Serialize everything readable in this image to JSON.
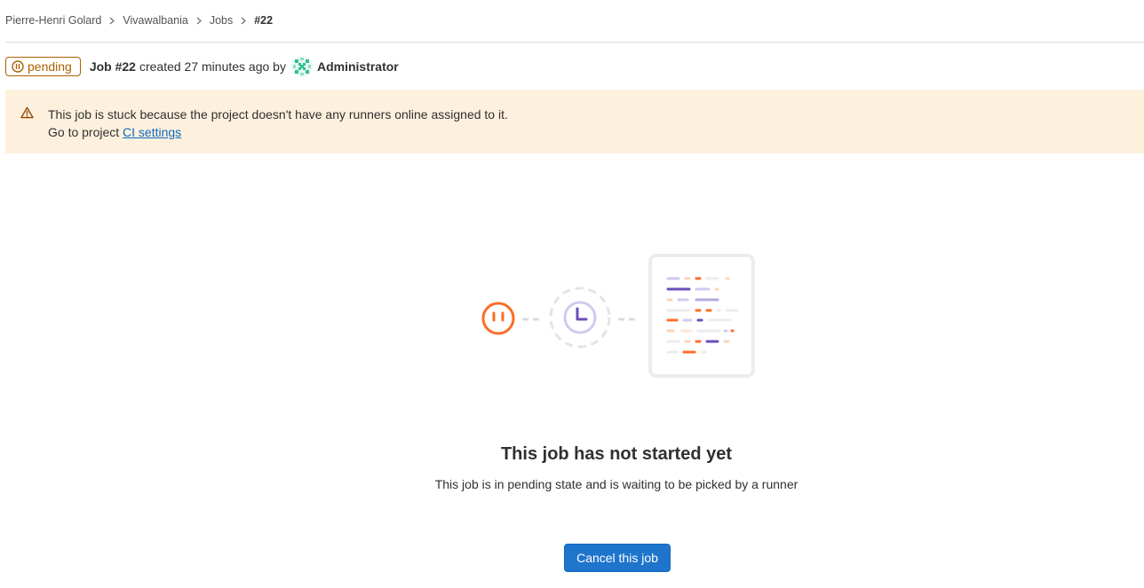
{
  "breadcrumb": [
    {
      "label": "Pierre-Henri Golard"
    },
    {
      "label": "Vivawalbania"
    },
    {
      "label": "Jobs"
    },
    {
      "label": "#22"
    }
  ],
  "header": {
    "status": "pending",
    "job_title": "Job #22",
    "meta": "created 27 minutes ago by",
    "author": "Administrator"
  },
  "alert": {
    "message": "This job is stuck because the project doesn't have any runners online assigned to it.",
    "prefix": "Go to project",
    "link": "CI settings"
  },
  "empty_state": {
    "title": "This job has not started yet",
    "description": "This job is in pending state and is waiting to be picked by a runner",
    "cancel_label": "Cancel this job"
  },
  "colors": {
    "pending": "#ab6100",
    "alert_bg": "#fdf1dd",
    "link": "#1068bf",
    "primary": "#1f75cb",
    "illustration_orange": "#fc6d26",
    "illustration_purple": "#6b4fbb"
  },
  "icons": {
    "status": "status-pending-icon",
    "warning": "warning-icon",
    "separator": "chevron-right-icon"
  }
}
